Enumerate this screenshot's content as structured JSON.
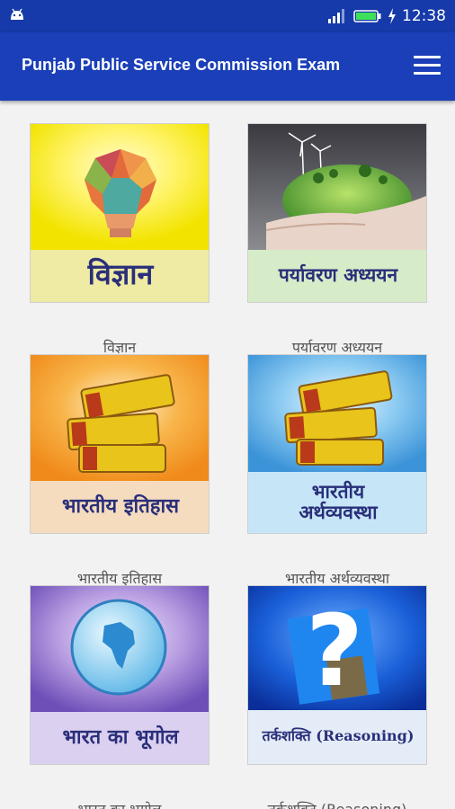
{
  "status_bar": {
    "time": "12:38"
  },
  "app_bar": {
    "title": "Punjab Public Service Commission Exam"
  },
  "tiles": [
    {
      "image_text": "विज्ञान",
      "caption": "विज्ञान"
    },
    {
      "image_text": "पर्यावरण अध्ययन",
      "caption": "पर्यावरण अध्ययन"
    },
    {
      "image_text": "भारतीय इतिहास",
      "caption": "भारतीय इतिहास"
    },
    {
      "image_text": "भारतीय अर्थव्यवस्था",
      "caption": "भारतीय अर्थव्यवस्था"
    },
    {
      "image_text": "भारत का भूगोल",
      "caption": "भारत का भगोल"
    },
    {
      "image_text": "तर्कशक्ति (Reasoning)",
      "caption": "तर्कशक्ति (Reasoning)"
    }
  ],
  "colors": {
    "primary": "#1a3fb8",
    "status_bar": "#163aa9",
    "background": "#f2f2f2"
  },
  "icons": {
    "menu": "hamburger-menu-icon",
    "status": [
      "android-notification-icon",
      "signal-icon",
      "battery-icon",
      "charging-icon"
    ]
  }
}
